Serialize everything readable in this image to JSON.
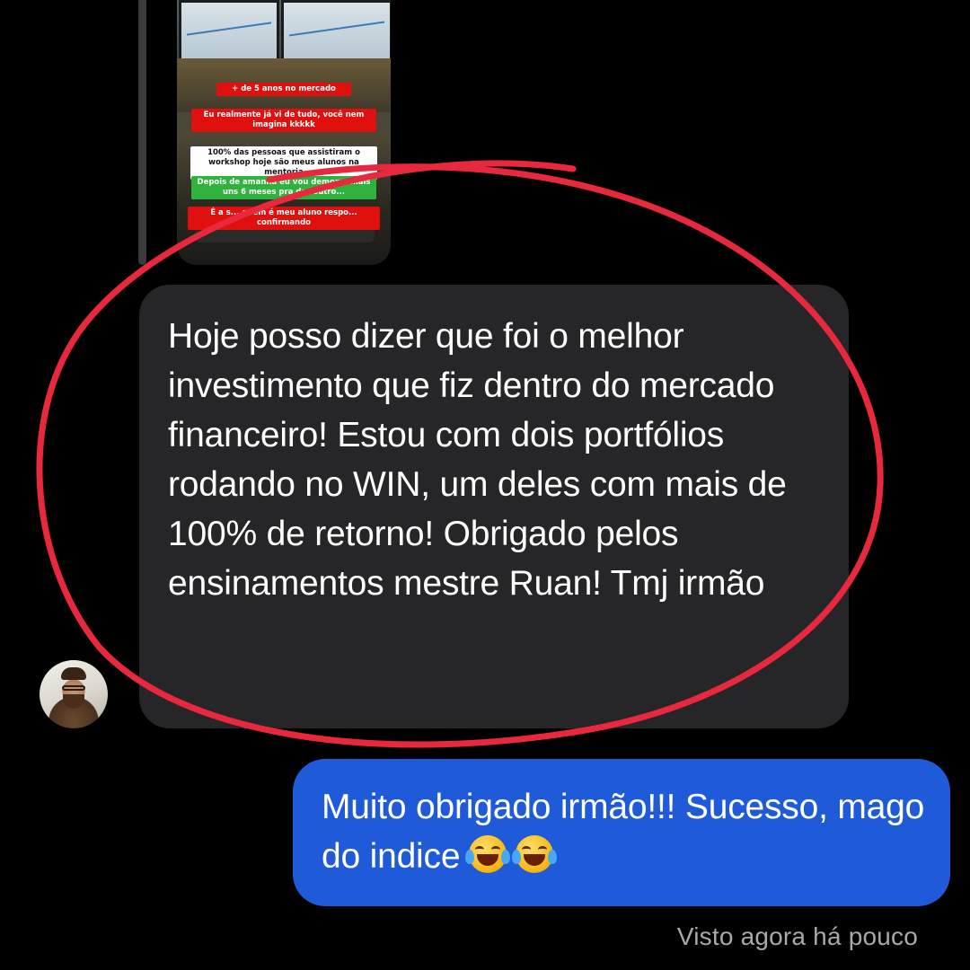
{
  "story": {
    "tags": [
      {
        "text": "+ de 5 anos no mercado",
        "color": "red"
      },
      {
        "text": "Eu realmente já vi de tudo, você nem imagina kkkkk",
        "color": "red"
      },
      {
        "text": "100% das pessoas que assistiram o workshop hoje são meus alunos na mentoria",
        "color": "white"
      },
      {
        "text": "Depois de amanhã eu vou demorar mais uns 6 meses pra dar outro...",
        "color": "green"
      },
      {
        "text": "É a s... quem é meu aluno respo... confirmando",
        "color": "red"
      }
    ]
  },
  "incoming": {
    "message": "Hoje posso dizer que foi o melhor investimento que fiz dentro do mercado financeiro! Estou com dois portfólios rodando no WIN, um deles com mais de 100% de retorno! Obrigado pelos ensinamentos mestre Ruan! Tmj irmão"
  },
  "outgoing": {
    "message": "Muito obrigado irmão!!! Sucesso, mago do indice",
    "emoji": [
      "face-with-tears-of-joy-icon",
      "face-with-tears-of-joy-icon"
    ]
  },
  "status": {
    "seen": "Visto agora há pouco"
  },
  "colors": {
    "background": "#000000",
    "incoming_bubble": "#262628",
    "outgoing_bubble": "#1f5bd8",
    "highlight_ellipse": "#e8283c",
    "status_text": "#a8a8ad"
  }
}
